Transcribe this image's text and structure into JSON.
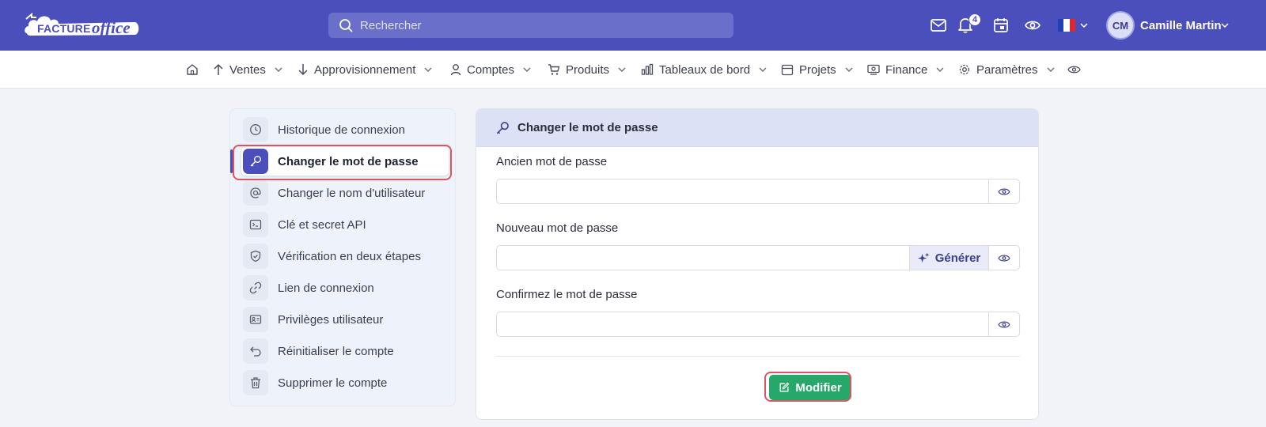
{
  "header": {
    "logo_word_a": "FACTURE",
    "logo_word_b": "office",
    "search_placeholder": "Rechercher",
    "notifications_count": "4",
    "user_initials": "CM",
    "user_name": "Camille Martin",
    "icons": [
      "mail-icon",
      "bell-icon",
      "calendar-icon",
      "eye-icon",
      "flag-fr",
      "chevron-down-icon"
    ],
    "colors": {
      "brand": "#4a4fbb",
      "success": "#27a86b",
      "highlight": "#e0525e"
    }
  },
  "nav": {
    "items": [
      {
        "label": "Ventes",
        "icon": "arrow-up-icon"
      },
      {
        "label": "Approvisionnement",
        "icon": "arrow-down-icon"
      },
      {
        "label": "Comptes",
        "icon": "user-icon"
      },
      {
        "label": "Produits",
        "icon": "cart-icon"
      },
      {
        "label": "Tableaux de bord",
        "icon": "bar-chart-icon"
      },
      {
        "label": "Projets",
        "icon": "calendar-icon"
      },
      {
        "label": "Finance",
        "icon": "money-icon"
      },
      {
        "label": "Paramètres",
        "icon": "gear-icon"
      }
    ]
  },
  "sidebar": {
    "items": [
      {
        "label": "Historique de connexion",
        "icon": "clock-icon"
      },
      {
        "label": "Changer le mot de passe",
        "icon": "key-icon",
        "active": true
      },
      {
        "label": "Changer le nom d'utilisateur",
        "icon": "at-icon"
      },
      {
        "label": "Clé et secret API",
        "icon": "terminal-icon"
      },
      {
        "label": "Vérification en deux étapes",
        "icon": "shield-icon"
      },
      {
        "label": "Lien de connexion",
        "icon": "link-icon"
      },
      {
        "label": "Privilèges utilisateur",
        "icon": "id-card-icon"
      },
      {
        "label": "Réinitialiser le compte",
        "icon": "undo-icon"
      },
      {
        "label": "Supprimer le compte",
        "icon": "trash-icon"
      }
    ]
  },
  "form": {
    "title": "Changer le mot de passe",
    "old_label": "Ancien mot de passe",
    "old_value": "",
    "new_label": "Nouveau mot de passe",
    "new_value": "",
    "generate_label": "Générer",
    "confirm_label": "Confirmez le mot de passe",
    "confirm_value": "",
    "submit_label": "Modifier"
  }
}
